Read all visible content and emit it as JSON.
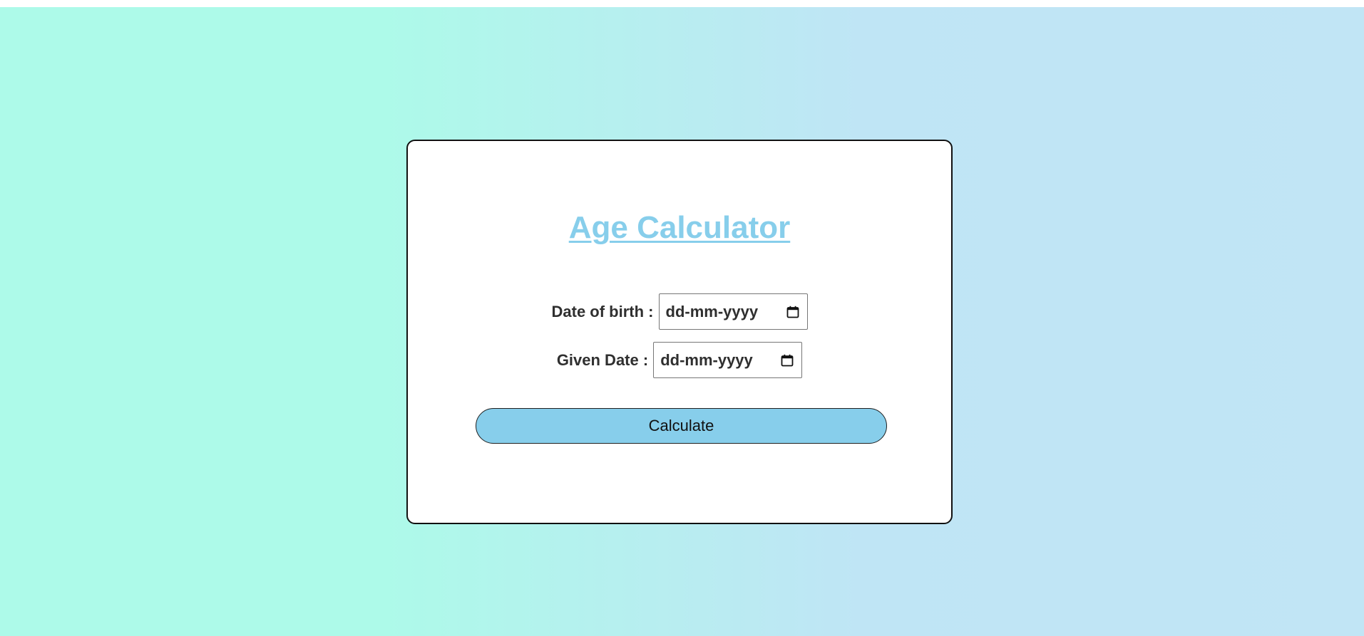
{
  "app": {
    "title": "Age Calculator"
  },
  "form": {
    "dob_label": "Date of birth :",
    "dob_placeholder": "dd-mm-yyyy",
    "given_label": "Given Date :",
    "given_placeholder": "dd-mm-yyyy",
    "calculate_label": "Calculate"
  },
  "icons": {
    "date_picker": "calendar-icon"
  },
  "colors": {
    "accent": "#87ceeb",
    "background_left": "#adfae9",
    "background_right": "#c1e5f5",
    "card": "#ffffff",
    "text": "#2f2f2f"
  }
}
